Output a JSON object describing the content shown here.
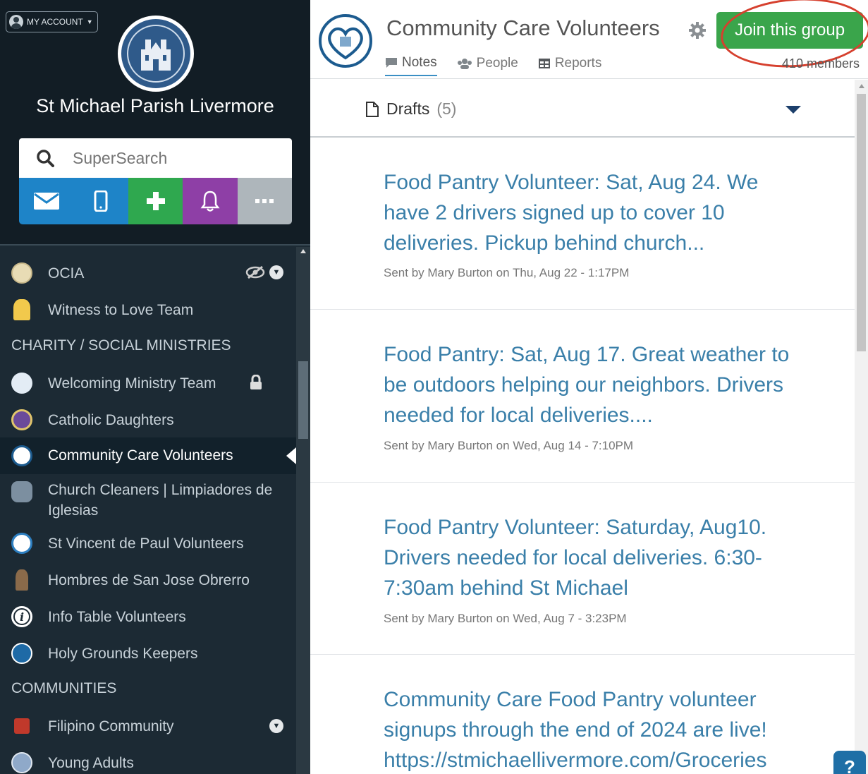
{
  "account": {
    "label": "MY ACCOUNT"
  },
  "parish": {
    "name": "St Michael Parish Livermore"
  },
  "search": {
    "placeholder": "SuperSearch"
  },
  "actions": [
    {
      "name": "message",
      "color": "#1e84c8"
    },
    {
      "name": "mobile",
      "color": "#1e84c8"
    },
    {
      "name": "add",
      "color": "#2fa84f"
    },
    {
      "name": "notifications",
      "color": "#8e3fa6"
    },
    {
      "name": "more",
      "color": "#aeb6bb"
    }
  ],
  "sidebar": {
    "items": [
      {
        "label": "OCIA"
      },
      {
        "label": "Witness to Love Team"
      },
      {
        "header": "CHARITY / SOCIAL MINISTRIES"
      },
      {
        "label": "Welcoming Ministry Team"
      },
      {
        "label": "Catholic Daughters"
      },
      {
        "label": "Community Care Volunteers"
      },
      {
        "label": "Church Cleaners | Limpiadores de Iglesias"
      },
      {
        "label": "St Vincent de Paul Volunteers"
      },
      {
        "label": "Hombres de San Jose Obrerro"
      },
      {
        "label": "Info Table Volunteers"
      },
      {
        "label": "Holy Grounds Keepers"
      },
      {
        "header": "COMMUNITIES"
      },
      {
        "label": "Filipino Community"
      },
      {
        "label": "Young Adults"
      }
    ]
  },
  "group": {
    "title": "Community Care Volunteers",
    "join_label": "Join this group",
    "members": "410 members",
    "tabs": [
      "Notes",
      "People",
      "Reports"
    ]
  },
  "drafts": {
    "label": "Drafts",
    "count": "(5)"
  },
  "notes": [
    {
      "title": "Food Pantry Volunteer: Sat, Aug 24. We have 2 drivers signed up to cover 10 deliveries. Pickup behind church...",
      "meta": "Sent by Mary Burton on Thu, Aug 22 - 1:17PM"
    },
    {
      "title": "Food Pantry: Sat, Aug 17. Great weather to be outdoors helping our neighbors. Drivers needed for local deliveries....",
      "meta": "Sent by Mary Burton on Wed, Aug 14 - 7:10PM"
    },
    {
      "title": "Food Pantry Volunteer: Saturday, Aug10. Drivers needed for local deliveries. 6:30-7:30am behind St Michael",
      "meta": "Sent by Mary Burton on Wed, Aug 7 - 3:23PM"
    },
    {
      "title": "Community Care Food Pantry volunteer signups through the end of 2024 are live! https://stmichaellivermore.com/Groceries",
      "meta": ""
    }
  ],
  "help": {
    "label": "?"
  }
}
